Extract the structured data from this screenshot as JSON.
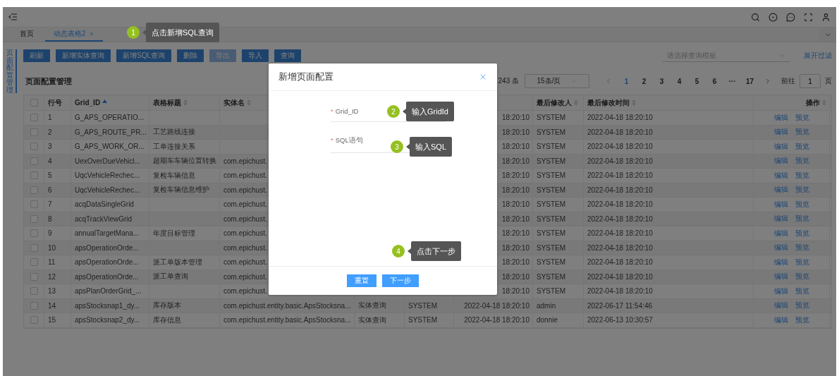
{
  "tabs": [
    {
      "label": "首页",
      "selected": false,
      "closable": false
    },
    {
      "label": "动态表格2",
      "selected": true,
      "closable": true
    }
  ],
  "side_tab": "页面配置管理",
  "toolbar": {
    "buttons": [
      {
        "label": "刷新",
        "disabled": false
      },
      {
        "label": "新增实体查询",
        "disabled": false
      },
      {
        "label": "新增SQL查询",
        "disabled": false
      },
      {
        "label": "删除",
        "disabled": false
      },
      {
        "label": "导出",
        "disabled": true
      },
      {
        "label": "导入",
        "disabled": false
      },
      {
        "label": "查询",
        "disabled": false
      }
    ],
    "template_select": {
      "placeholder": "请选择查询模板"
    },
    "filter_link": "展开过滤"
  },
  "section_title": "页面配置管理",
  "pagination": {
    "total": "243 条",
    "page_size": "15条/页",
    "pages": [
      {
        "label": "1",
        "selected": true
      },
      {
        "label": "2",
        "selected": false
      },
      {
        "label": "3",
        "selected": false
      },
      {
        "label": "4",
        "selected": false
      },
      {
        "label": "5",
        "selected": false
      },
      {
        "label": "6",
        "selected": false
      },
      {
        "label": "···",
        "selected": false
      },
      {
        "label": "17",
        "selected": false
      }
    ],
    "goto_label": "前往",
    "goto_value": "1",
    "goto_unit": "页"
  },
  "table": {
    "header_checked": false,
    "columns": [
      {
        "label": "行号",
        "sortable": false
      },
      {
        "label": "Grid_ID",
        "sortable": true,
        "sorted": true
      },
      {
        "label": "表格标题",
        "sortable": true,
        "sorted": false
      },
      {
        "label": "实体名",
        "sortable": true,
        "sorted": false
      },
      {
        "label": "最后修改人",
        "sortable": true,
        "sorted": false
      },
      {
        "label": "最后修改时间",
        "sortable": true,
        "sorted": false
      },
      {
        "label": "操作",
        "sortable": true,
        "sorted": false
      }
    ],
    "rows": [
      {
        "checked": false,
        "no": "1",
        "grid_id": "G_APS_OPERATIO...",
        "created": "18:20:10",
        "modifier": "SYSTEM",
        "modified": "2022-04-18 18:20:10",
        "actions": [
          "编辑",
          "预览"
        ]
      },
      {
        "checked": false,
        "no": "2",
        "grid_id": "G_APS_ROUTE_PR...",
        "title": "工艺路线连接",
        "created": "18:20:10",
        "modifier": "SYSTEM",
        "modified": "2022-04-18 18:20:10",
        "actions": [
          "编辑",
          "预览"
        ]
      },
      {
        "checked": false,
        "no": "3",
        "grid_id": "G_APS_WORK_OR...",
        "title": "工单连接关系",
        "created": "18:20:10",
        "modifier": "SYSTEM",
        "modified": "2022-04-18 18:20:10",
        "actions": [
          "编辑",
          "预览"
        ]
      },
      {
        "checked": false,
        "no": "4",
        "grid_id": "UexOverDueVehicl...",
        "title": "超期车车辆位置转换",
        "entity": "com.epichust.",
        "created": "18:20:10",
        "modifier": "SYSTEM",
        "modified": "2022-04-18 18:20:10",
        "actions": [
          "编辑",
          "预览"
        ]
      },
      {
        "checked": false,
        "no": "5",
        "grid_id": "UqcVehicleRechec...",
        "title": "复检车辆信息",
        "entity": "com.epichust.",
        "created": "18:20:10",
        "modifier": "SYSTEM",
        "modified": "2022-04-18 18:20:10",
        "actions": [
          "编辑",
          "预览"
        ]
      },
      {
        "checked": false,
        "no": "6",
        "grid_id": "UqcVehicleRechec...",
        "title": "复检车辆信息维护",
        "entity": "com.epichust.",
        "created": "18:20:10",
        "modifier": "SYSTEM",
        "modified": "2022-04-18 18:20:10",
        "actions": [
          "编辑",
          "预览"
        ]
      },
      {
        "checked": false,
        "no": "7",
        "grid_id": "acqDataSingleGrid",
        "entity": "com.epichust.",
        "created": "18:20:10",
        "modifier": "SYSTEM",
        "modified": "2022-04-18 18:20:10",
        "actions": [
          "编辑",
          "预览"
        ]
      },
      {
        "checked": false,
        "no": "8",
        "grid_id": "acqTrackViewGrid",
        "entity": "com.epichust.",
        "created": "18:20:10",
        "modifier": "SYSTEM",
        "modified": "2022-04-18 18:20:10",
        "actions": [
          "编辑",
          "预览"
        ]
      },
      {
        "checked": false,
        "no": "9",
        "grid_id": "annualTargetMana...",
        "title": "年度目标管理",
        "entity": "com.epichust.",
        "created": "18:20:10",
        "modifier": "SYSTEM",
        "modified": "2022-04-18 18:20:10",
        "actions": [
          "编辑",
          "预览"
        ]
      },
      {
        "checked": false,
        "no": "10",
        "grid_id": "apsOperationOrde...",
        "entity": "com.epichust.",
        "created": "18:20:10",
        "modifier": "SYSTEM",
        "modified": "2022-04-18 18:20:10",
        "actions": [
          "编辑",
          "预览"
        ]
      },
      {
        "checked": false,
        "no": "11",
        "grid_id": "apsOperationOrde...",
        "title": "派工单版本管理",
        "entity": "com.epichust.",
        "created": "18:20:10",
        "modifier": "SYSTEM",
        "modified": "2022-04-18 18:20:10",
        "actions": [
          "编辑",
          "预览"
        ]
      },
      {
        "checked": false,
        "no": "12",
        "grid_id": "apsOperationOrde...",
        "title": "派工单查询",
        "entity": "com.epichust.",
        "created": "18:20:10",
        "modifier": "SYSTEM",
        "modified": "2022-04-18 18:20:10",
        "actions": [
          "编辑",
          "预览"
        ]
      },
      {
        "checked": false,
        "no": "13",
        "grid_id": "apsPlanOrderGrid_...",
        "entity": "com.epichust.",
        "created": "18:20:10",
        "modifier": "SYSTEM",
        "modified": "2022-04-18 18:20:10",
        "actions": [
          "编辑",
          "预览"
        ]
      },
      {
        "checked": false,
        "no": "14",
        "grid_id": "apsStocksnap1_dy...",
        "title": "库存版本",
        "entity": "com.epichust.entity.basic.ApsStocksna...",
        "type": "实体查询",
        "creator": "SYSTEM",
        "created": "2022-04-18 18:20:10",
        "modifier": "admin",
        "modified": "2022-06-17 11:54:46",
        "actions": [
          "编辑",
          "预览"
        ]
      },
      {
        "checked": false,
        "no": "15",
        "grid_id": "apsStocksnap2_dy...",
        "title": "库存信息",
        "entity": "com.epichust.entity.basic.ApsStocksna...",
        "type": "实体查询",
        "creator": "SYSTEM",
        "created": "2022-04-18 18:20:10",
        "modifier": "donnie",
        "modified": "2022-06-13 10:30:57",
        "actions": [
          "编辑",
          "预览"
        ]
      }
    ]
  },
  "dialog": {
    "title": "新增页面配置",
    "fields": [
      {
        "kind": "input",
        "label": "Grid_ID",
        "required_mark": "*"
      },
      {
        "kind": "textarea",
        "label": "SQL语句",
        "required_mark": "*"
      }
    ],
    "buttons": [
      "重置",
      "下一步"
    ]
  },
  "callouts": [
    {
      "number": "1",
      "text": "点击新增SQL查询"
    },
    {
      "number": "2",
      "text": "输入GridId"
    },
    {
      "number": "3",
      "text": "输入SQL"
    },
    {
      "number": "4",
      "text": "点击下一步"
    }
  ]
}
